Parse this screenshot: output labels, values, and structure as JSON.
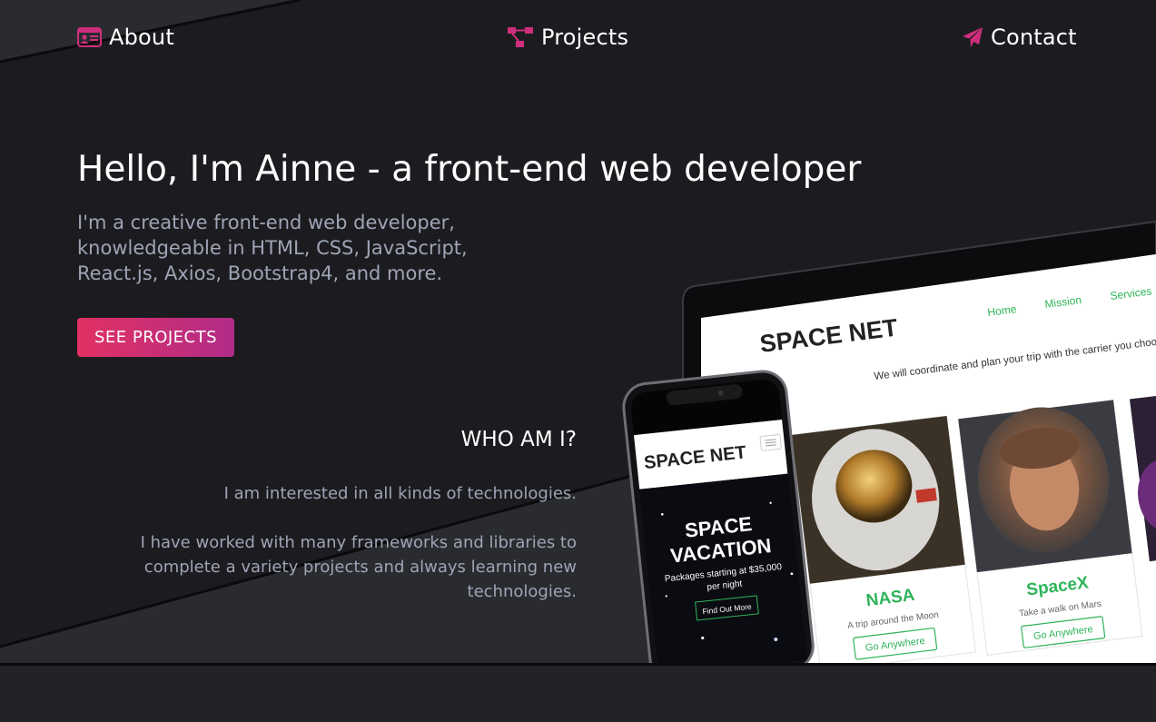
{
  "nav": {
    "about": "About",
    "projects": "Projects",
    "contact": "Contact"
  },
  "hero": {
    "title": "Hello, I'm Ainne - a front-end web developer",
    "subtitle": "I'm a creative front-end web developer, knowledgeable in HTML, CSS, JavaScript, React.js, Axios, Bootstrap4, and more.",
    "cta_label": "SEE PROJECTS"
  },
  "about": {
    "heading": "WHO AM I?",
    "paragraph_1": "I am interested in all kinds of technologies.",
    "paragraph_2": "I have worked with many frameworks and libraries to complete a variety projects and always learning new technologies."
  },
  "mockup": {
    "laptop_brand": "SPACE NET",
    "laptop_nav": [
      "Home",
      "Mission",
      "Services"
    ],
    "laptop_tagline": "We will coordinate and plan your trip with the carrier you choo",
    "cards": [
      {
        "title": "NASA",
        "text": "A trip around the Moon",
        "button": "Go Anywhere"
      },
      {
        "title": "SpaceX",
        "text": "Take a walk on Mars",
        "button": "Go Anywhere"
      }
    ],
    "phone_brand": "SPACE NET",
    "phone_hero_line1": "SPACE",
    "phone_hero_line2": "VACATION",
    "phone_hero_sub1": "Packages starting at $35,000",
    "phone_hero_sub2": "per night",
    "phone_button": "Find Out More"
  },
  "colors": {
    "accent_pink": "#e23163",
    "accent_purple": "#b02c88",
    "icon_pink": "#cf2e7c",
    "background": "#1c1c20",
    "text_muted": "#9ea4b5",
    "card_green": "#2fb45a"
  },
  "icons": {
    "about": "id-card-icon",
    "projects": "sitemap-icon",
    "contact": "paper-plane-icon"
  }
}
